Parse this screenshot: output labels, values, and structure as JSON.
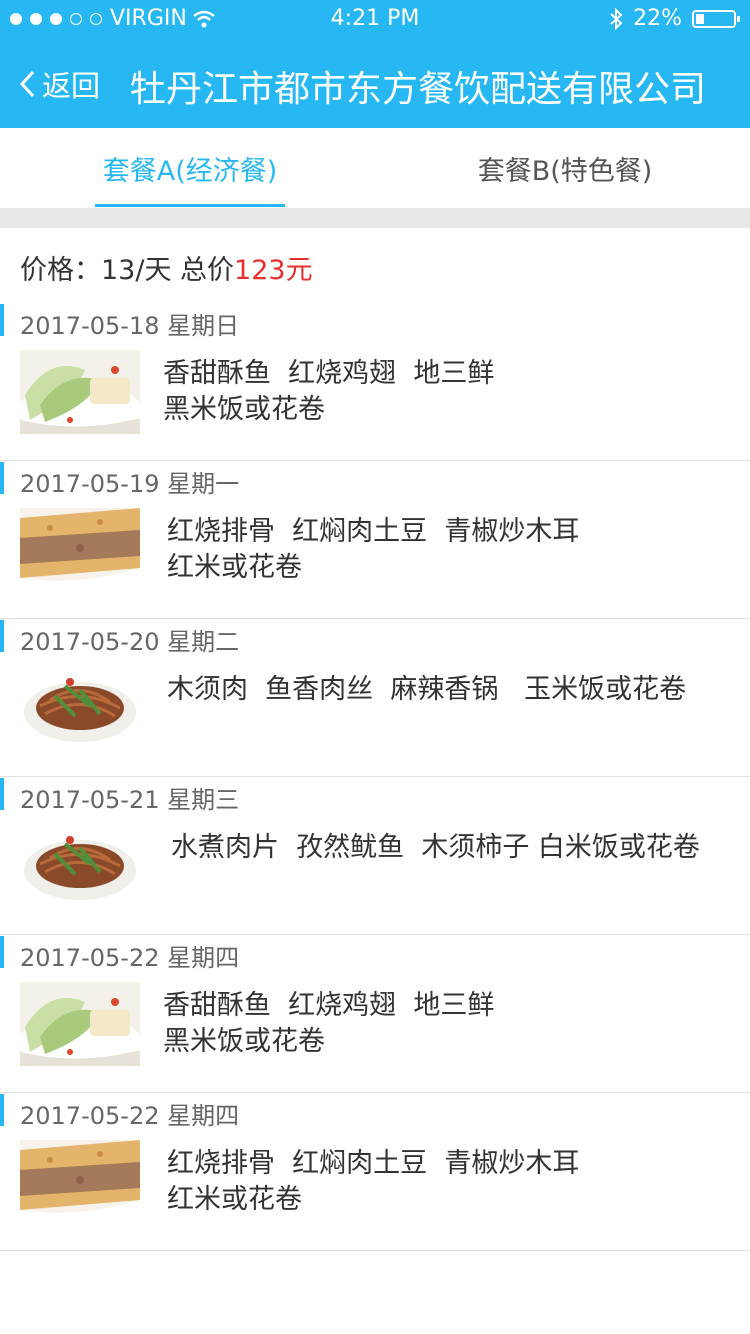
{
  "status_bar": {
    "carrier": "VIRGIN",
    "time": "4:21 PM",
    "battery": "22%",
    "battery_level": 0.22
  },
  "nav": {
    "back_label": "返回",
    "title": "牡丹江市都市东方餐饮配送有限公司"
  },
  "tabs": [
    {
      "label": "套餐A(经济餐)",
      "active": true
    },
    {
      "label": "套餐B(特色餐)",
      "active": false
    }
  ],
  "price": {
    "label": "价格：13/天  总价",
    "total": "123元"
  },
  "days": [
    {
      "date": "2017-05-18  星期日",
      "image": "cabbage-dish",
      "line1": "香甜酥鱼  红烧鸡翅  地三鲜",
      "line2": "黑米饭或花卷"
    },
    {
      "date": "2017-05-19  星期一",
      "image": "pancake-dish",
      "line1": "红烧排骨  红焖肉土豆  青椒炒木耳",
      "line2": "红米或花卷"
    },
    {
      "date": "2017-05-20  星期二",
      "image": "noodle-dish",
      "line1": "木须肉  鱼香肉丝  麻辣香锅   玉米饭或花卷",
      "line2": ""
    },
    {
      "date": "2017-05-21  星期三",
      "image": "noodle-dish",
      "line1": "水煮肉片  孜然鱿鱼  木须柿子 白米饭或花卷",
      "line2": ""
    },
    {
      "date": "2017-05-22  星期四",
      "image": "cabbage-dish",
      "line1": "香甜酥鱼  红烧鸡翅  地三鲜",
      "line2": "黑米饭或花卷"
    },
    {
      "date": "2017-05-22  星期四",
      "image": "pancake-dish",
      "line1": "红烧排骨  红焖肉土豆  青椒炒木耳",
      "line2": "红米或花卷"
    }
  ],
  "colors": {
    "accent": "#27b8f3",
    "price_red": "#e5312f",
    "header_bg": "#27b8f3"
  }
}
